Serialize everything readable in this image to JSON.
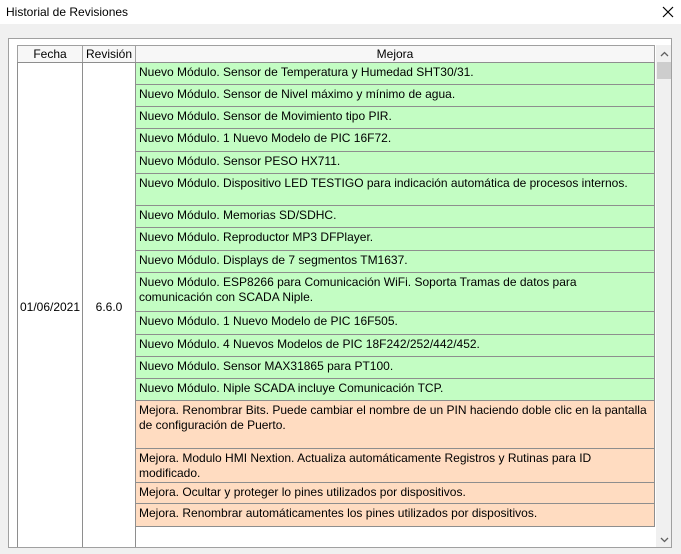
{
  "window": {
    "title": "Historial de Revisiones",
    "close_icon": "close-icon"
  },
  "table": {
    "headers": {
      "fecha": "Fecha",
      "revision": "Revisión",
      "mejora": "Mejora"
    },
    "date": "01/06/2021",
    "revision": "6.6.0",
    "rows": [
      {
        "text": "Nuevo Módulo. Sensor de Temperatura y Humedad SHT30/31.",
        "kind": "green"
      },
      {
        "text": "Nuevo Módulo. Sensor de Nivel máximo y mínimo de agua.",
        "kind": "green"
      },
      {
        "text": "Nuevo Módulo. Sensor de Movimiento tipo PIR.",
        "kind": "green"
      },
      {
        "text": "Nuevo Módulo. 1 Nuevo Modelo de PIC 16F72.",
        "kind": "green"
      },
      {
        "text": "Nuevo Módulo. Sensor PESO HX711.",
        "kind": "green"
      },
      {
        "text": "Nuevo Módulo. Dispositivo LED TESTIGO para indicación automática de procesos internos.",
        "kind": "green"
      },
      {
        "text": "Nuevo Módulo. Memorias SD/SDHC.",
        "kind": "green"
      },
      {
        "text": "Nuevo Módulo. Reproductor MP3 DFPlayer.",
        "kind": "green"
      },
      {
        "text": "Nuevo Módulo. Displays de 7 segmentos TM1637.",
        "kind": "green"
      },
      {
        "text": "Nuevo Módulo. ESP8266 para Comunicación WiFi. Soporta Tramas de datos para comunicación con SCADA Niple.",
        "kind": "green"
      },
      {
        "text": "Nuevo Módulo. 1 Nuevo Modelo de PIC 16F505.",
        "kind": "green"
      },
      {
        "text": "Nuevo Módulo. 4 Nuevos Modelos de PIC 18F242/252/442/452.",
        "kind": "green"
      },
      {
        "text": "Nuevo Módulo. Sensor MAX31865 para PT100.",
        "kind": "green"
      },
      {
        "text": "Nuevo Módulo. Niple SCADA incluye Comunicación TCP.",
        "kind": "green"
      },
      {
        "text": "Mejora. Renombrar Bits. Puede cambiar el nombre de un PIN haciendo doble clic en la pantalla de configuración de Puerto.",
        "kind": "orange"
      },
      {
        "text": "Mejora. Modulo HMI Nextion. Actualiza automáticamente Registros y Rutinas para ID modificado.",
        "kind": "orange"
      },
      {
        "text": "Mejora. Ocultar y proteger lo pines utilizados por dispositivos.",
        "kind": "orange"
      },
      {
        "text": "Mejora. Renombrar automáticamentes los pines utilizados por dispositivos.",
        "kind": "orange"
      }
    ]
  },
  "colors": {
    "new_module": "#c3fdc3",
    "improvement": "#ffdcc1"
  }
}
